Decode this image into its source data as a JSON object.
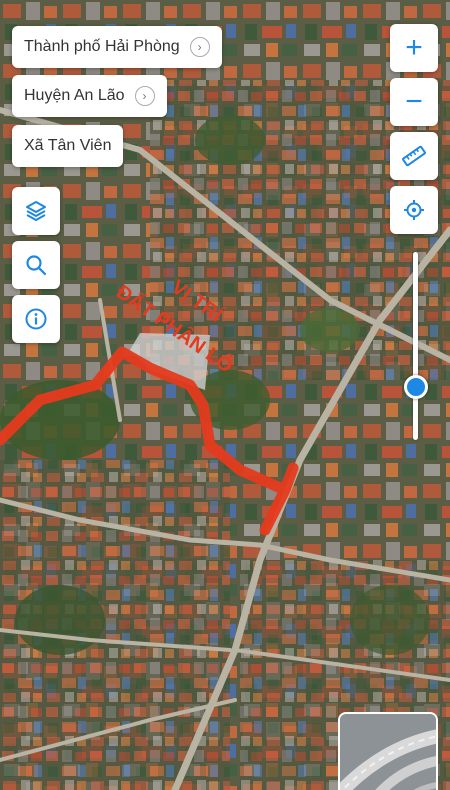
{
  "breadcrumbs": [
    {
      "label": "Thành phố Hải Phòng",
      "has_arrow": true
    },
    {
      "label": "Huyện An Lão",
      "has_arrow": true
    },
    {
      "label": "Xã Tân Viên",
      "has_arrow": false
    }
  ],
  "annotation": {
    "line1": "VỊ TRÍ",
    "line2": "ĐẤT PHÂN LÔ",
    "color": "#e53a1e"
  },
  "left_tools": [
    {
      "name": "layers-icon"
    },
    {
      "name": "search-icon"
    },
    {
      "name": "info-icon"
    }
  ],
  "right_tools": {
    "zoom_in": "+",
    "zoom_out": "−"
  },
  "zoom_level_fraction": 0.72,
  "colors": {
    "accent": "#1e88e5",
    "route": "#e53a1e"
  }
}
